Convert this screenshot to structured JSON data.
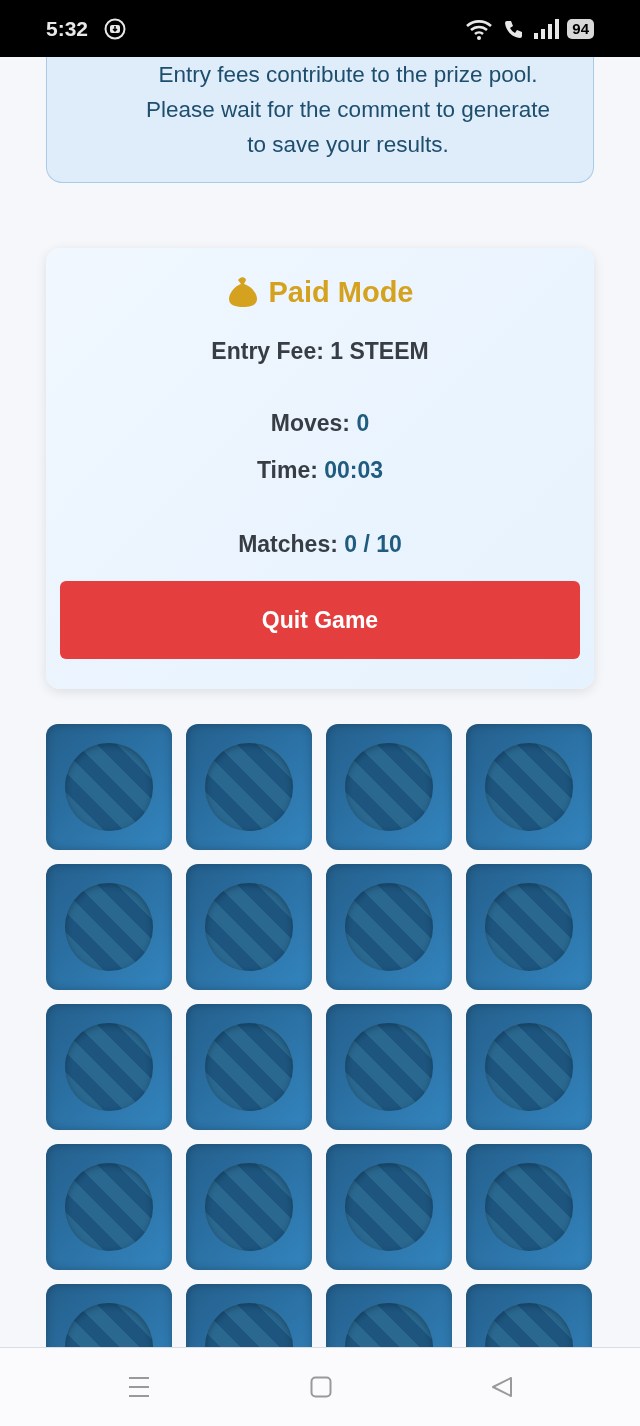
{
  "status_bar": {
    "time": "5:32",
    "battery": "94"
  },
  "notice": {
    "text": "Entry fees contribute to the prize pool. Please wait for the comment to generate to save your results."
  },
  "game_panel": {
    "title": "Paid Mode",
    "entry_fee": "Entry Fee: 1 STEEM",
    "stats": [
      {
        "label": "Moves:",
        "value": "0"
      },
      {
        "label": "Time:",
        "value": "00:03"
      },
      {
        "label": "Matches:",
        "value": "0 / 10"
      }
    ]
  },
  "quit_button": "Quit Game",
  "cards": [
    {
      "flipped": false
    },
    {
      "flipped": false
    },
    {
      "flipped": false
    },
    {
      "flipped": false
    },
    {
      "flipped": false
    },
    {
      "flipped": false
    },
    {
      "flipped": false
    },
    {
      "flipped": false
    },
    {
      "flipped": false
    },
    {
      "flipped": false
    },
    {
      "flipped": false
    },
    {
      "flipped": false
    },
    {
      "flipped": false
    },
    {
      "flipped": false
    },
    {
      "flipped": false
    },
    {
      "flipped": false
    },
    {
      "flipped": false
    },
    {
      "flipped": false
    },
    {
      "flipped": false
    },
    {
      "flipped": false
    }
  ]
}
